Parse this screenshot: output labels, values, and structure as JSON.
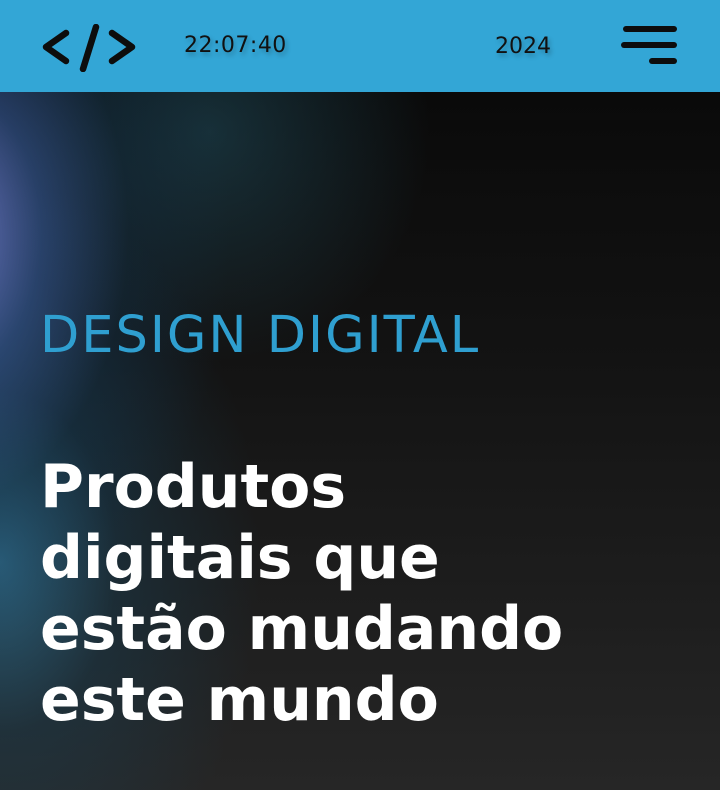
{
  "header": {
    "logo_icon": "code-brackets-icon",
    "clock_text": "22:07:40",
    "year_text": "2024",
    "menu_icon": "hamburger-menu-icon",
    "background_color": "#33a6d6"
  },
  "hero": {
    "kicker": "DESIGN DIGITAL",
    "headline_lines": [
      "Produtos",
      "digitais que",
      "estão mudando",
      "este mundo"
    ],
    "kicker_color": "#2f9fd0",
    "headline_color": "#ffffff"
  }
}
